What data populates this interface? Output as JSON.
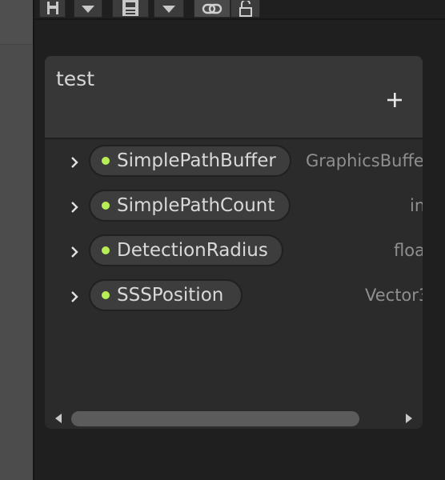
{
  "blackboard": {
    "title": "test",
    "add_icon": "plus-icon",
    "properties": [
      {
        "name": "SimplePathBuffer",
        "type": "GraphicsBuffe"
      },
      {
        "name": "SimplePathCount",
        "type": "in"
      },
      {
        "name": "DetectionRadius",
        "type": "floa"
      },
      {
        "name": "SSSPosition",
        "type": "Vector3"
      }
    ]
  },
  "toolbar": {
    "icons": [
      "save-icon",
      "dropdown-icon",
      "save-as-icon",
      "dropdown-icon",
      "link-icon",
      "lock-icon"
    ]
  },
  "scrollbar": {
    "position_fraction": 0.0,
    "visible_fraction": 0.9
  },
  "colors": {
    "property_dot": "#b6ee54",
    "panel_bg": "#2b2b2b",
    "header_bg": "#373737",
    "pill_bg": "#3d3d3d"
  }
}
